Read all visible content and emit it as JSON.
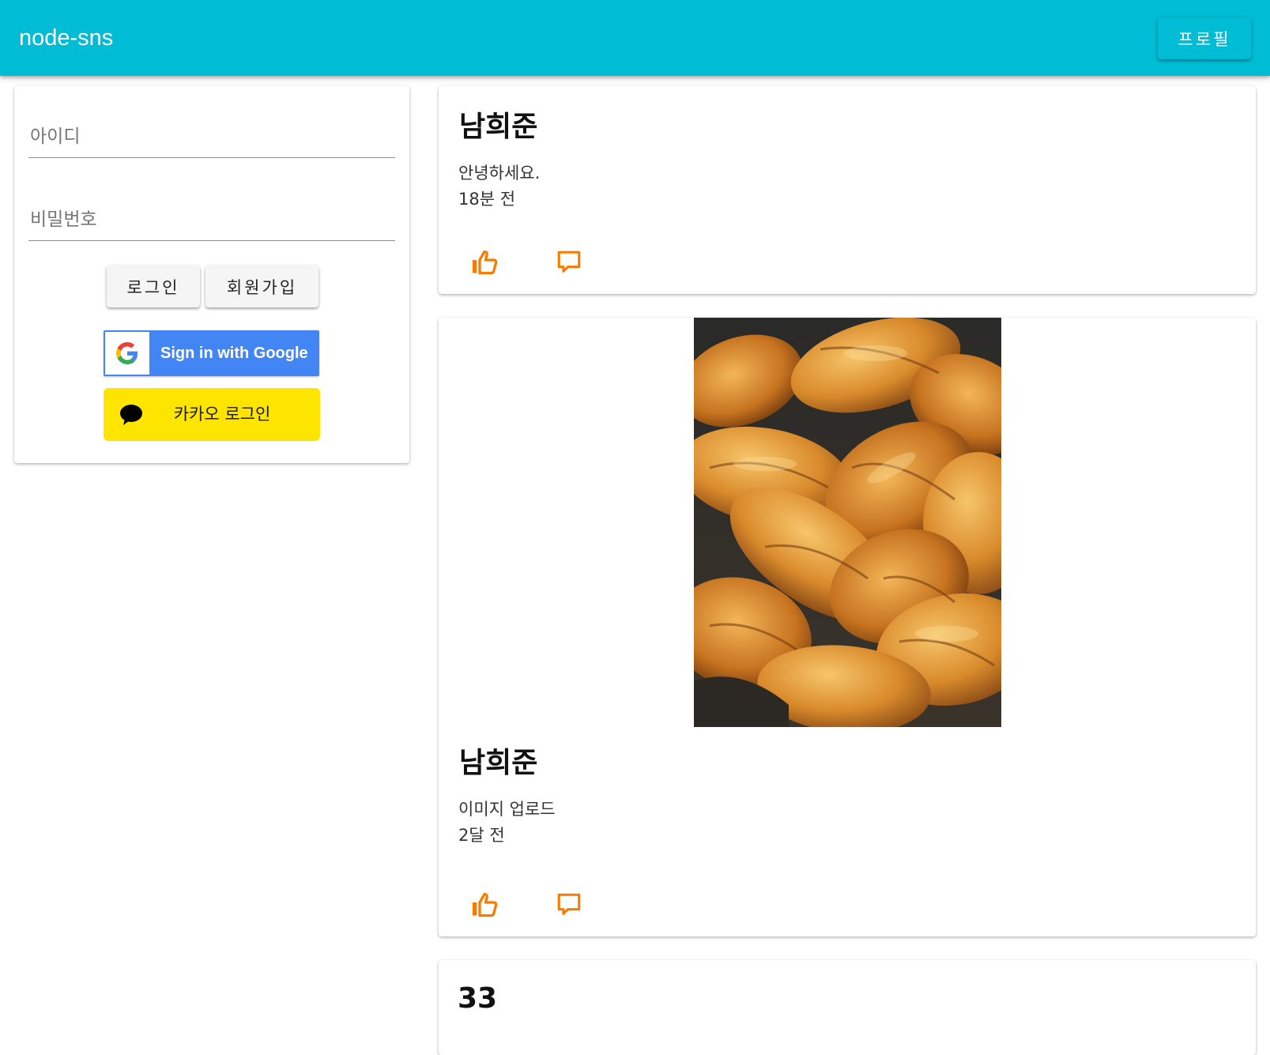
{
  "app": {
    "title": "node-sns",
    "accent_color": "#00bcd4"
  },
  "header": {
    "profile_label": "프로필"
  },
  "login": {
    "id_placeholder": "아이디",
    "password_placeholder": "비밀번호",
    "login_label": "로그인",
    "signup_label": "회원가입",
    "google_label": "Sign in with Google",
    "kakao_label": "카카오 로그인"
  },
  "posts": [
    {
      "author": "남희준",
      "content": "안녕하세요.",
      "time": "18분 전",
      "has_image": false
    },
    {
      "author": "남희준",
      "content": "이미지 업로드",
      "time": "2달 전",
      "has_image": true,
      "image_desc": "croissants-photo"
    },
    {
      "author": "33"
    }
  ],
  "icons": {
    "like": "thumb-up-icon",
    "comment": "comment-icon",
    "icon_color": "#f57c00"
  }
}
